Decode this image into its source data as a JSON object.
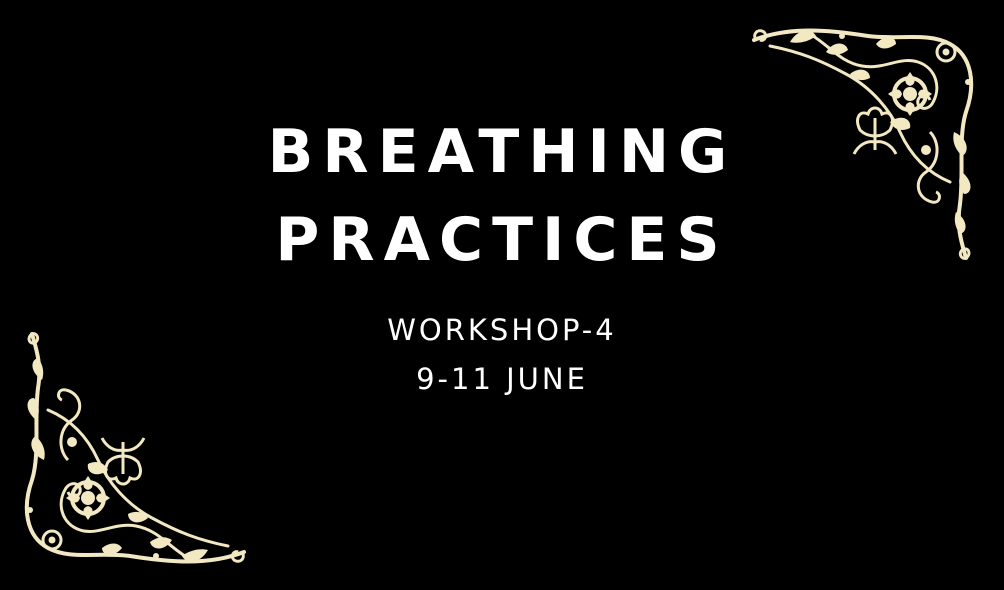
{
  "poster": {
    "title_line_1": "BREATHING",
    "title_line_2": "PRACTICES",
    "subtitle": "WORKSHOP-4",
    "dates": "9-11 JUNE"
  },
  "decorations": {
    "top_right": "floral-corner-ornament",
    "bottom_left": "floral-corner-ornament"
  },
  "colors": {
    "background": "#000000",
    "text": "#ffffff",
    "ornament": "#f2e8c2"
  }
}
